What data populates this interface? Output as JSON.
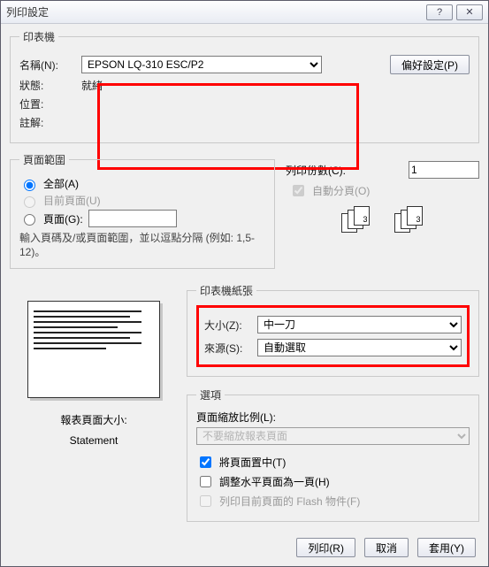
{
  "window": {
    "title": "列印設定"
  },
  "printer": {
    "legend": "印表機",
    "name_label": "名稱(N):",
    "name_value": "EPSON LQ-310 ESC/P2",
    "status_label": "狀態:",
    "status_value": "就緒",
    "location_label": "位置:",
    "location_value": "",
    "comment_label": "註解:",
    "comment_value": "",
    "pref_button": "偏好設定(P)"
  },
  "range": {
    "legend": "頁面範圍",
    "all_label": "全部(A)",
    "current_label": "目前頁面(U)",
    "pages_label": "頁面(G):",
    "pages_value": "",
    "hint": "輸入頁碼及/或頁面範圍，並以逗點分隔 (例如: 1,5-12)。"
  },
  "copies": {
    "label": "列印份數(C):",
    "value": "1",
    "collate_label": "自動分頁(O)"
  },
  "paper": {
    "legend": "印表機紙張",
    "size_label": "大小(Z):",
    "size_value": "中一刀",
    "source_label": "來源(S):",
    "source_value": "自動選取"
  },
  "options": {
    "legend": "選項",
    "scale_label": "頁面縮放比例(L):",
    "scale_value": "不要縮放報表頁面",
    "center_label": "將頁面置中(T)",
    "fit_horiz_label": "調整水平頁面為一頁(H)",
    "flash_label": "列印目前頁面的 Flash 物件(F)"
  },
  "preview": {
    "title": "報表頁面大小:",
    "value": "Statement"
  },
  "footer": {
    "print": "列印(R)",
    "cancel": "取消",
    "apply": "套用(Y)"
  }
}
